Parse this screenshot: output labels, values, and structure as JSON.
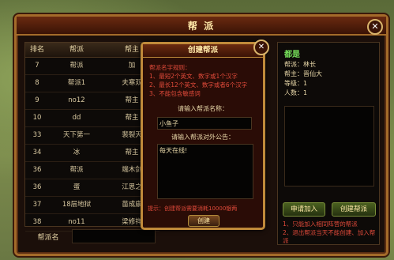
{
  "main": {
    "title": "帮 派",
    "close": "✕"
  },
  "list": {
    "headers": [
      "排名",
      "帮派",
      "帮主"
    ],
    "rows": [
      [
        "7",
        "帮派",
        "加"
      ],
      [
        "8",
        "帮派1",
        "夫寒双"
      ],
      [
        "9",
        "no12",
        "帮主"
      ],
      [
        "10",
        "dd",
        "帮主"
      ],
      [
        "33",
        "天下第一",
        "裴裂天"
      ],
      [
        "34",
        "冰",
        "帮主"
      ],
      [
        "36",
        "帮派",
        "端木剑"
      ],
      [
        "36",
        "蛋",
        "江思之"
      ],
      [
        "37",
        "18层地狱",
        "苗成康"
      ],
      [
        "38",
        "no11",
        "梁修祥"
      ]
    ]
  },
  "name_search": {
    "label": "帮派名",
    "value": ""
  },
  "info": {
    "title": "都是",
    "lines": [
      "帮派：林长",
      "帮主：晋仙大",
      "等级：1",
      "人数：1"
    ],
    "apply_button": "申请加入",
    "create_button": "创建帮派",
    "notes": [
      "1、只能加入相同阵营的帮派",
      "2、退出帮派当天不能创建、加入帮派"
    ]
  },
  "dialog": {
    "title": "创建帮派",
    "close": "✕",
    "rules": [
      "帮派名字规则：",
      "1、最短2个英文、数字或1个汉字",
      "2、最长12个英文、数字或者6个汉字",
      "3、不能包含敏感词"
    ],
    "name_label": "请输入帮派名称：",
    "name_value": "小鱼子",
    "notice_label": "请输入帮派对外公告：",
    "notice_value": "每天在线!",
    "tip": "提示：创建帮派需要消耗10000银两",
    "create_button": "创建"
  }
}
